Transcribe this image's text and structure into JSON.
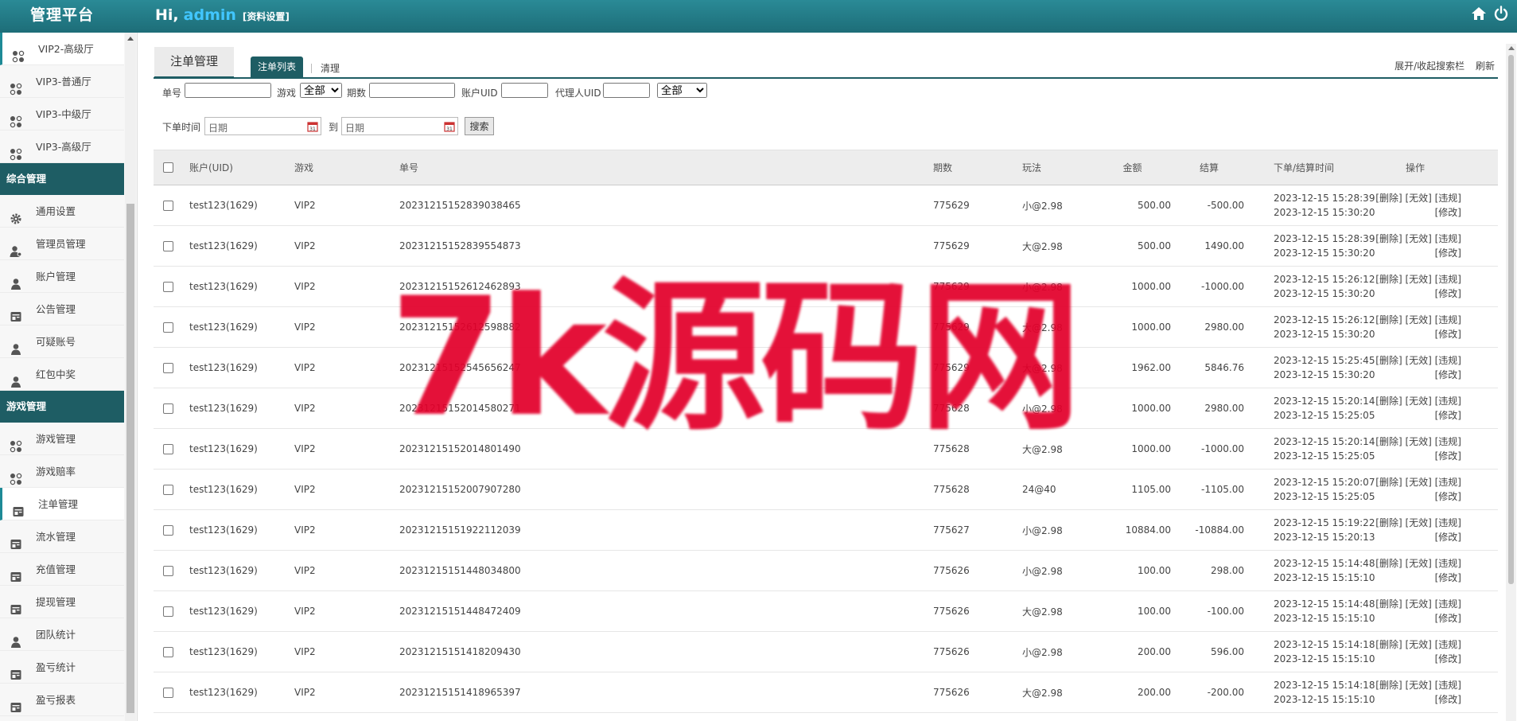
{
  "app": {
    "brand": "管理平台",
    "greeting_prefix": "Hi,",
    "username": "admin",
    "profile_link": "[资料设置]",
    "home_icon": "home-icon",
    "power_icon": "power-icon",
    "accent_color": "#1e5d64",
    "topbar_color": "#2a8a96"
  },
  "sidebar": {
    "items_top": [
      {
        "label": "VIP2-高级厅",
        "icon": "grid-icon",
        "active": true
      },
      {
        "label": "VIP3-普通厅",
        "icon": "grid-icon"
      },
      {
        "label": "VIP3-中级厅",
        "icon": "grid-icon"
      },
      {
        "label": "VIP3-高级厅",
        "icon": "grid-icon"
      }
    ],
    "section_general": "综合管理",
    "items_general": [
      {
        "label": "通用设置",
        "icon": "gear-icon"
      },
      {
        "label": "管理员管理",
        "icon": "admin-user-icon"
      },
      {
        "label": "账户管理",
        "icon": "user-icon"
      },
      {
        "label": "公告管理",
        "icon": "document-icon"
      },
      {
        "label": "可疑账号",
        "icon": "user-icon"
      },
      {
        "label": "红包中奖",
        "icon": "user-icon"
      }
    ],
    "section_game": "游戏管理",
    "items_game": [
      {
        "label": "游戏管理",
        "icon": "grid-icon"
      },
      {
        "label": "游戏赔率",
        "icon": "grid-icon"
      },
      {
        "label": "注单管理",
        "icon": "document-icon",
        "active": true
      },
      {
        "label": "流水管理",
        "icon": "document-icon"
      },
      {
        "label": "充值管理",
        "icon": "document-icon"
      },
      {
        "label": "提现管理",
        "icon": "document-icon"
      },
      {
        "label": "团队统计",
        "icon": "user-icon"
      },
      {
        "label": "盈亏统计",
        "icon": "document-icon"
      },
      {
        "label": "盈亏报表",
        "icon": "document-icon"
      }
    ]
  },
  "main": {
    "page_tab": "注单管理",
    "sub_tab_active": "注单列表",
    "sub_tab_other": "清理",
    "toggle_search": "展开/收起搜索栏",
    "refresh": "刷新"
  },
  "filters": {
    "order_no_label": "单号",
    "game_label": "游戏",
    "game_selected": "全部",
    "period_label": "期数",
    "account_uid_label": "账户UID",
    "agent_uid_label": "代理人UID",
    "extra_selected": "全部",
    "time_label": "下单时间",
    "date_placeholder": "日期",
    "to_label": "到",
    "search_button": "搜索"
  },
  "table": {
    "headers": {
      "account": "账户(UID)",
      "game": "游戏",
      "order_no": "单号",
      "period": "期数",
      "play": "玩法",
      "amount": "金额",
      "settle": "结算",
      "time": "下单/结算时间",
      "ops": "操作"
    },
    "ops_line1": "[删除] [无效] [违规]",
    "ops_line2": "[修改]",
    "rows": [
      {
        "account": "test123(1629)",
        "game": "VIP2",
        "order_no": "20231215152839038465",
        "period": "775629",
        "play": "小@2.98",
        "amount": "500.00",
        "settle": "-500.00",
        "order_time": "2023-12-15 15:28:39",
        "settle_time": "2023-12-15 15:30:20"
      },
      {
        "account": "test123(1629)",
        "game": "VIP2",
        "order_no": "20231215152839554873",
        "period": "775629",
        "play": "大@2.98",
        "amount": "500.00",
        "settle": "1490.00",
        "order_time": "2023-12-15 15:28:39",
        "settle_time": "2023-12-15 15:30:20"
      },
      {
        "account": "test123(1629)",
        "game": "VIP2",
        "order_no": "20231215152612462893",
        "period": "775629",
        "play": "小@2.98",
        "amount": "1000.00",
        "settle": "-1000.00",
        "order_time": "2023-12-15 15:26:12",
        "settle_time": "2023-12-15 15:30:20"
      },
      {
        "account": "test123(1629)",
        "game": "VIP2",
        "order_no": "20231215152612598882",
        "period": "775629",
        "play": "大@2.98",
        "amount": "1000.00",
        "settle": "2980.00",
        "order_time": "2023-12-15 15:26:12",
        "settle_time": "2023-12-15 15:30:20"
      },
      {
        "account": "test123(1629)",
        "game": "VIP2",
        "order_no": "20231215152545656247",
        "period": "775629",
        "play": "大@2.98",
        "amount": "1962.00",
        "settle": "5846.76",
        "order_time": "2023-12-15 15:25:45",
        "settle_time": "2023-12-15 15:30:20"
      },
      {
        "account": "test123(1629)",
        "game": "VIP2",
        "order_no": "20231215152014580271",
        "period": "775628",
        "play": "小@2.98",
        "amount": "1000.00",
        "settle": "2980.00",
        "order_time": "2023-12-15 15:20:14",
        "settle_time": "2023-12-15 15:25:05"
      },
      {
        "account": "test123(1629)",
        "game": "VIP2",
        "order_no": "20231215152014801490",
        "period": "775628",
        "play": "大@2.98",
        "amount": "1000.00",
        "settle": "-1000.00",
        "order_time": "2023-12-15 15:20:14",
        "settle_time": "2023-12-15 15:25:05"
      },
      {
        "account": "test123(1629)",
        "game": "VIP2",
        "order_no": "20231215152007907280",
        "period": "775628",
        "play": "24@40",
        "amount": "1105.00",
        "settle": "-1105.00",
        "order_time": "2023-12-15 15:20:07",
        "settle_time": "2023-12-15 15:25:05"
      },
      {
        "account": "test123(1629)",
        "game": "VIP2",
        "order_no": "20231215151922112039",
        "period": "775627",
        "play": "小@2.98",
        "amount": "10884.00",
        "settle": "-10884.00",
        "order_time": "2023-12-15 15:19:22",
        "settle_time": "2023-12-15 15:20:13"
      },
      {
        "account": "test123(1629)",
        "game": "VIP2",
        "order_no": "20231215151448034800",
        "period": "775626",
        "play": "小@2.98",
        "amount": "100.00",
        "settle": "298.00",
        "order_time": "2023-12-15 15:14:48",
        "settle_time": "2023-12-15 15:15:10"
      },
      {
        "account": "test123(1629)",
        "game": "VIP2",
        "order_no": "20231215151448472409",
        "period": "775626",
        "play": "大@2.98",
        "amount": "100.00",
        "settle": "-100.00",
        "order_time": "2023-12-15 15:14:48",
        "settle_time": "2023-12-15 15:15:10"
      },
      {
        "account": "test123(1629)",
        "game": "VIP2",
        "order_no": "20231215151418209430",
        "period": "775626",
        "play": "小@2.98",
        "amount": "200.00",
        "settle": "596.00",
        "order_time": "2023-12-15 15:14:18",
        "settle_time": "2023-12-15 15:15:10"
      },
      {
        "account": "test123(1629)",
        "game": "VIP2",
        "order_no": "20231215151418965397",
        "period": "775626",
        "play": "大@2.98",
        "amount": "200.00",
        "settle": "-200.00",
        "order_time": "2023-12-15 15:14:18",
        "settle_time": "2023-12-15 15:15:10"
      }
    ]
  },
  "watermark": {
    "text": "7k源码网",
    "color": "#e3002b"
  }
}
